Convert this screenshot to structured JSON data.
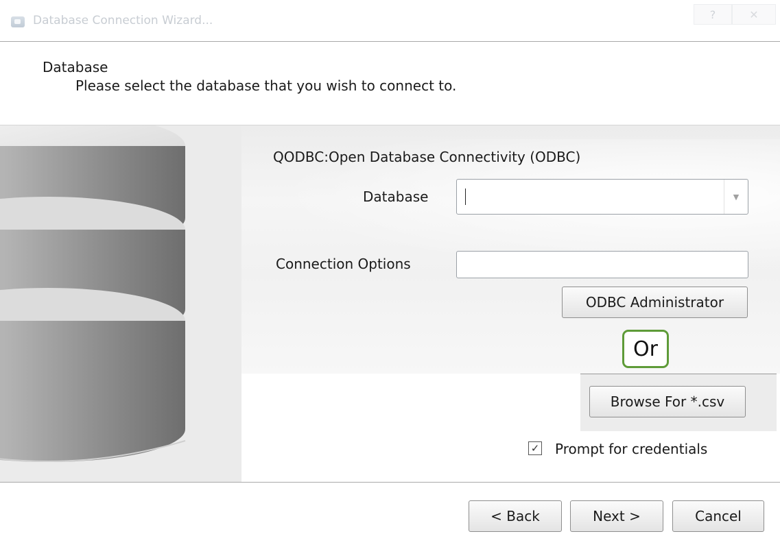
{
  "window": {
    "title": "Database Connection Wizard...",
    "help_label": "?",
    "close_label": "✕"
  },
  "header": {
    "title": "Database",
    "subtitle": "Please select the database that you wish to connect to."
  },
  "form": {
    "driver_label": "QODBC:Open Database Connectivity (ODBC)",
    "database_label": "Database",
    "database_value": "",
    "connection_options_label": "Connection Options",
    "connection_options_value": "",
    "odbc_admin_label": "ODBC Administrator",
    "or_label": "Or",
    "browse_label": "Browse For *.csv",
    "prompt_label": "Prompt for credentials",
    "prompt_checked": true
  },
  "footer": {
    "back_label": "< Back",
    "next_label": "Next >",
    "cancel_label": "Cancel"
  },
  "colors": {
    "highlight_border": "#5e9b38"
  }
}
